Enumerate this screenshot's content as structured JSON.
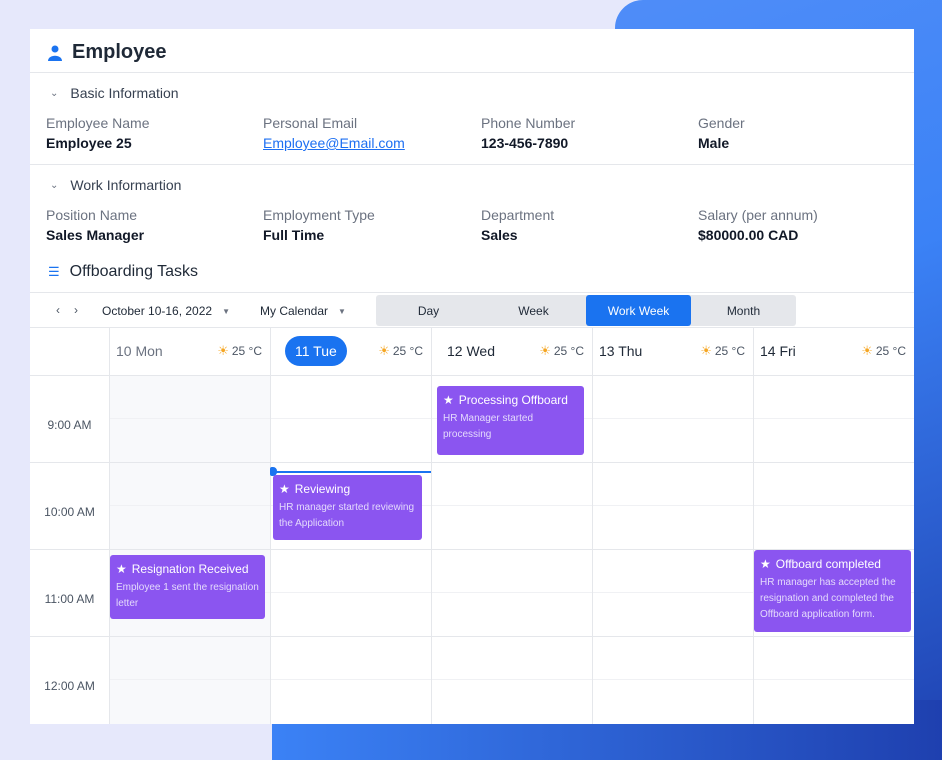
{
  "page": {
    "title": "Employee",
    "icon": "user-icon"
  },
  "basic": {
    "title": "Basic Information",
    "fields": [
      {
        "label": "Employee Name",
        "value": "Employee 25"
      },
      {
        "label": "Personal Email",
        "value": "Employee@Email.com"
      },
      {
        "label": "Phone Number",
        "value": "123-456-7890"
      },
      {
        "label": "Gender",
        "value": "Male"
      }
    ]
  },
  "work": {
    "title": "Work Informartion",
    "fields": [
      {
        "label": "Position Name",
        "value": "Sales Manager"
      },
      {
        "label": "Employment Type",
        "value": "Full Time"
      },
      {
        "label": "Department",
        "value": "Sales"
      },
      {
        "label": "Salary (per annum)",
        "value": "$80000.00 CAD"
      }
    ]
  },
  "tasks": {
    "title": "Offboarding Tasks",
    "icon": "list-icon"
  },
  "toolbar": {
    "date_range": "October 10-16, 2022",
    "calendar": "My Calendar",
    "views": [
      "Day",
      "Week",
      "Work Week",
      "Month"
    ],
    "active_view": "Work Week"
  },
  "days": [
    {
      "label": "10 Mon",
      "temp": "25 °C"
    },
    {
      "label": "11 Tue",
      "temp": "25 °C",
      "today": true
    },
    {
      "label": "12 Wed",
      "temp": "25 °C"
    },
    {
      "label": "13 Thu",
      "temp": "25 °C"
    },
    {
      "label": "14 Fri",
      "temp": "25 °C"
    }
  ],
  "times": [
    "9:00 AM",
    "10:00 AM",
    "11:00 AM",
    "12:00 AM"
  ],
  "events": [
    {
      "title": "Processing Offboard",
      "desc": "HR Manager started processing",
      "day": "12 Wed"
    },
    {
      "title": "Reviewing",
      "desc": "HR manager started reviewing the Application",
      "day": "11 Tue"
    },
    {
      "title": "Resignation Received",
      "desc": "Employee 1 sent the resignation letter",
      "day": "10 Mon"
    },
    {
      "title": "Offboard completed",
      "desc": "HR manager has accepted the resignation and completed the Offboard application form.",
      "day": "14 Fri"
    }
  ],
  "colors": {
    "accent": "#1a73f0",
    "event": "#8b55f0"
  }
}
